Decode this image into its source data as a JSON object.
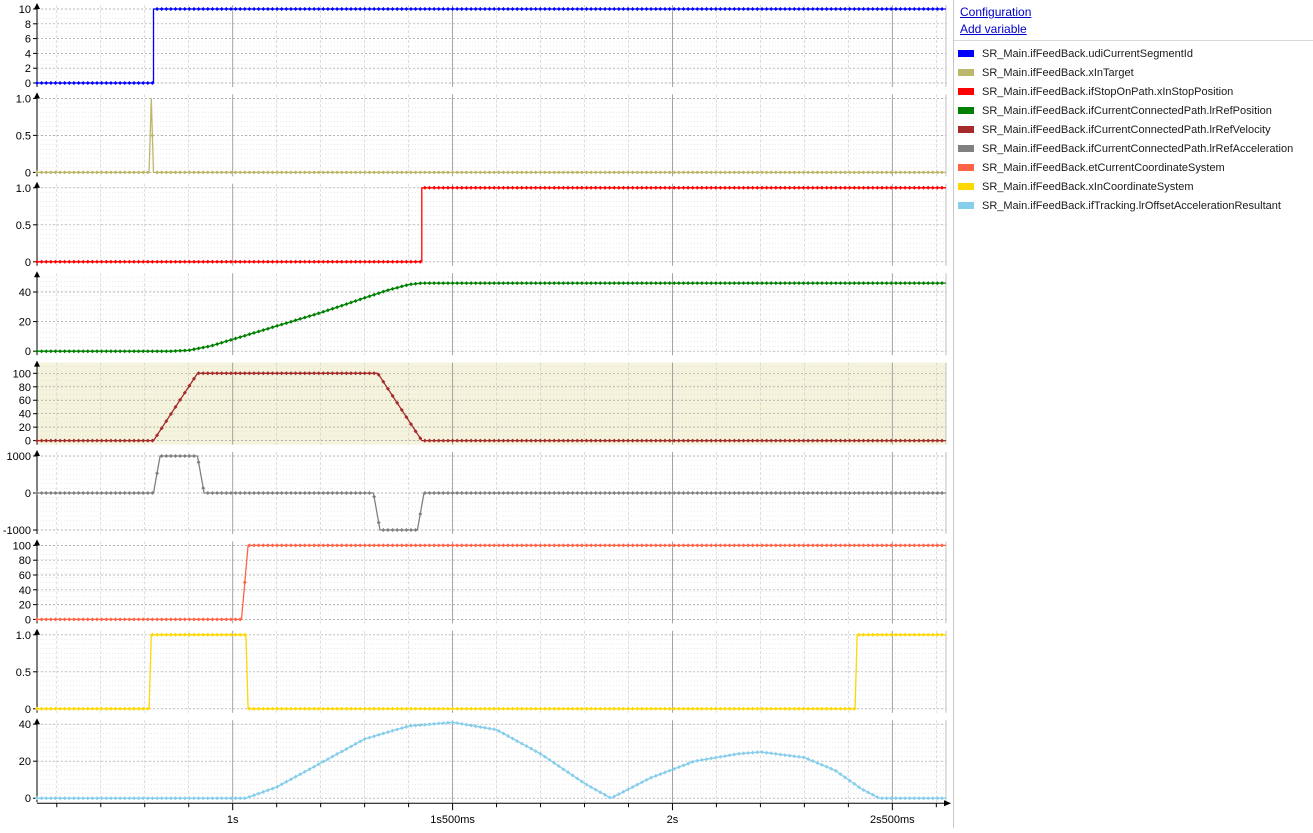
{
  "panel": {
    "configuration_link": "Configuration",
    "add_variable_link": "Add variable"
  },
  "legend": [
    {
      "name": "SR_Main.ifFeedBack.udiCurrentSegmentId",
      "color": "#0000ff"
    },
    {
      "name": "SR_Main.ifFeedBack.xInTarget",
      "color": "#bdb76b"
    },
    {
      "name": "SR_Main.ifFeedBack.ifStopOnPath.xInStopPosition",
      "color": "#ff0000"
    },
    {
      "name": "SR_Main.ifFeedBack.ifCurrentConnectedPath.lrRefPosition",
      "color": "#008000"
    },
    {
      "name": "SR_Main.ifFeedBack.ifCurrentConnectedPath.lrRefVelocity",
      "color": "#a52a2a"
    },
    {
      "name": "SR_Main.ifFeedBack.ifCurrentConnectedPath.lrRefAcceleration",
      "color": "#808080"
    },
    {
      "name": "SR_Main.ifFeedBack.etCurrentCoordinateSystem",
      "color": "#ff6347"
    },
    {
      "name": "SR_Main.ifFeedBack.xInCoordinateSystem",
      "color": "#ffd700"
    },
    {
      "name": "SR_Main.ifFeedBack.ifTracking.lrOffsetAccelerationResultant",
      "color": "#87ceeb"
    }
  ],
  "chart_data": {
    "type": "line",
    "x_unit": "s",
    "xlim": [
      0.555,
      2.622
    ],
    "x_ticks": [
      {
        "value": 1.0,
        "label": "1s"
      },
      {
        "value": 1.5,
        "label": "1s500ms"
      },
      {
        "value": 2.0,
        "label": "2s"
      },
      {
        "value": 2.5,
        "label": "2s500ms"
      }
    ],
    "panels": [
      {
        "series": "SR_Main.ifFeedBack.udiCurrentSegmentId",
        "color": "#0000ff",
        "ylim": [
          0,
          10
        ],
        "yticks": [
          0,
          2,
          4,
          6,
          8,
          10
        ],
        "ytick_labels": [
          "0",
          "2",
          "4",
          "6",
          "8",
          "10"
        ],
        "points": [
          [
            0.555,
            0
          ],
          [
            0.82,
            0
          ],
          [
            0.82,
            10
          ],
          [
            2.622,
            10
          ]
        ]
      },
      {
        "series": "SR_Main.ifFeedBack.xInTarget",
        "color": "#bdb76b",
        "ylim": [
          0,
          1
        ],
        "yticks": [
          0,
          0.5,
          1
        ],
        "ytick_labels": [
          "0",
          "0.5",
          "1.0"
        ],
        "points": [
          [
            0.555,
            0
          ],
          [
            0.81,
            0
          ],
          [
            0.815,
            1
          ],
          [
            0.82,
            0
          ],
          [
            2.622,
            0
          ]
        ]
      },
      {
        "series": "SR_Main.ifFeedBack.ifStopOnPath.xInStopPosition",
        "color": "#ff0000",
        "ylim": [
          0,
          1
        ],
        "yticks": [
          0,
          0.5,
          1
        ],
        "ytick_labels": [
          "0",
          "0.5",
          "1.0"
        ],
        "points": [
          [
            0.555,
            0
          ],
          [
            1.43,
            0
          ],
          [
            1.43,
            1
          ],
          [
            2.622,
            1
          ]
        ]
      },
      {
        "series": "SR_Main.ifFeedBack.ifCurrentConnectedPath.lrRefPosition",
        "color": "#008000",
        "ylim": [
          0,
          50
        ],
        "yticks": [
          0,
          20,
          40
        ],
        "ytick_labels": [
          "0",
          "20",
          "40"
        ],
        "points": [
          [
            0.555,
            0
          ],
          [
            0.86,
            0
          ],
          [
            0.9,
            0.6
          ],
          [
            0.95,
            3.5
          ],
          [
            1.0,
            8
          ],
          [
            1.1,
            17
          ],
          [
            1.2,
            26
          ],
          [
            1.3,
            36
          ],
          [
            1.35,
            41
          ],
          [
            1.4,
            45
          ],
          [
            1.43,
            46
          ],
          [
            2.622,
            46
          ]
        ]
      },
      {
        "series": "SR_Main.ifFeedBack.ifCurrentConnectedPath.lrRefVelocity",
        "color": "#a52a2a",
        "ylim": [
          0,
          110
        ],
        "yticks": [
          0,
          20,
          40,
          60,
          80,
          100
        ],
        "ytick_labels": [
          "0",
          "20",
          "40",
          "60",
          "80",
          "100"
        ],
        "highlight": true,
        "points": [
          [
            0.555,
            0
          ],
          [
            0.82,
            0
          ],
          [
            0.92,
            100
          ],
          [
            1.33,
            100
          ],
          [
            1.43,
            0
          ],
          [
            2.622,
            0
          ]
        ]
      },
      {
        "series": "SR_Main.ifFeedBack.ifCurrentConnectedPath.lrRefAcceleration",
        "color": "#808080",
        "ylim": [
          -1000,
          1000
        ],
        "yticks": [
          -1000,
          0,
          1000
        ],
        "ytick_labels": [
          "-1000",
          "0",
          "1000"
        ],
        "points": [
          [
            0.555,
            0
          ],
          [
            0.82,
            0
          ],
          [
            0.835,
            1000
          ],
          [
            0.92,
            1000
          ],
          [
            0.935,
            0
          ],
          [
            1.32,
            0
          ],
          [
            1.335,
            -1000
          ],
          [
            1.42,
            -1000
          ],
          [
            1.435,
            0
          ],
          [
            2.622,
            0
          ]
        ]
      },
      {
        "series": "SR_Main.ifFeedBack.etCurrentCoordinateSystem",
        "color": "#ff6347",
        "ylim": [
          0,
          100
        ],
        "yticks": [
          0,
          20,
          40,
          60,
          80,
          100
        ],
        "ytick_labels": [
          "0",
          "20",
          "40",
          "60",
          "80",
          "100"
        ],
        "points": [
          [
            0.555,
            0
          ],
          [
            1.02,
            0
          ],
          [
            1.035,
            100
          ],
          [
            2.622,
            100
          ]
        ]
      },
      {
        "series": "SR_Main.ifFeedBack.xInCoordinateSystem",
        "color": "#ffd700",
        "ylim": [
          0,
          1
        ],
        "yticks": [
          0,
          0.5,
          1
        ],
        "ytick_labels": [
          "0",
          "0.5",
          "1.0"
        ],
        "points": [
          [
            0.555,
            0
          ],
          [
            0.81,
            0
          ],
          [
            0.815,
            1
          ],
          [
            1.03,
            1
          ],
          [
            1.035,
            0
          ],
          [
            2.415,
            0
          ],
          [
            2.42,
            1
          ],
          [
            2.622,
            1
          ]
        ]
      },
      {
        "series": "SR_Main.ifFeedBack.ifTracking.lrOffsetAccelerationResultant",
        "color": "#87ceeb",
        "ylim": [
          0,
          40
        ],
        "yticks": [
          0,
          20,
          40
        ],
        "ytick_labels": [
          "0",
          "20",
          "40"
        ],
        "points": [
          [
            0.555,
            0
          ],
          [
            1.03,
            0
          ],
          [
            1.1,
            6
          ],
          [
            1.2,
            19
          ],
          [
            1.3,
            32
          ],
          [
            1.4,
            39
          ],
          [
            1.5,
            41
          ],
          [
            1.6,
            37
          ],
          [
            1.7,
            24
          ],
          [
            1.8,
            8
          ],
          [
            1.86,
            0
          ],
          [
            1.95,
            11
          ],
          [
            2.05,
            20
          ],
          [
            2.15,
            24
          ],
          [
            2.2,
            25
          ],
          [
            2.3,
            22
          ],
          [
            2.37,
            15
          ],
          [
            2.43,
            5
          ],
          [
            2.47,
            0
          ],
          [
            2.622,
            0
          ]
        ]
      }
    ]
  }
}
